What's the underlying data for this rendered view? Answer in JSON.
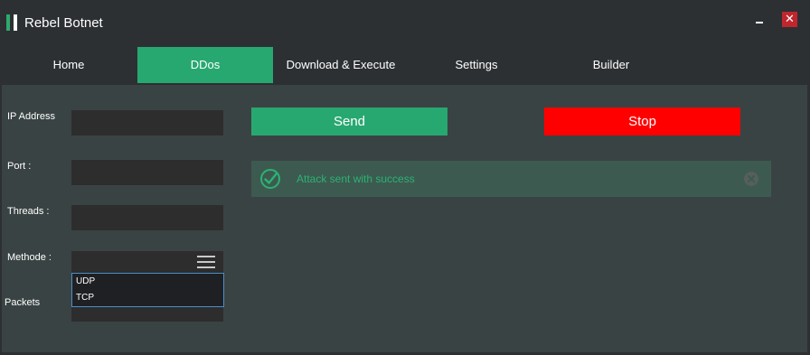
{
  "window": {
    "title": "Rebel Botnet",
    "close_glyph": "✕"
  },
  "tabs": [
    {
      "label": "Home"
    },
    {
      "label": "DDos",
      "active": true
    },
    {
      "label": "Download & Execute"
    },
    {
      "label": "Settings"
    },
    {
      "label": "Builder"
    }
  ],
  "form": {
    "ip_label": "IP Address",
    "port_label": "Port  :",
    "threads_label": "Threads :",
    "method_label": "Methode  :",
    "packets_label": "Packets",
    "ip_value": "",
    "port_value": "",
    "threads_value": "",
    "method_value": "",
    "packets_value": "",
    "method_options": [
      "UDP",
      "TCP"
    ]
  },
  "actions": {
    "send_label": "Send",
    "stop_label": "Stop"
  },
  "alert": {
    "message": "Attack sent with success",
    "icon": "check-circle-icon"
  },
  "colors": {
    "accent": "#28a871",
    "stop": "#ff0000",
    "panel": "#3a4343",
    "alert_bg": "#3d5a50",
    "close": "#c0262d"
  }
}
